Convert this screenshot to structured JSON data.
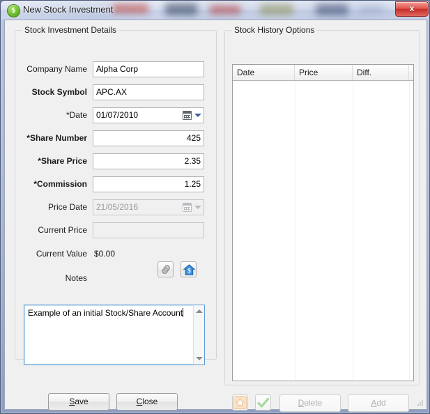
{
  "window": {
    "title": "New Stock Investment",
    "icon": "dollar-circle-icon",
    "close_label": "x"
  },
  "details_group": {
    "title": "Stock Investment Details",
    "fields": [
      {
        "label": "Company Name",
        "value": "Alpha Corp",
        "bold": false,
        "type": "text",
        "align": "left",
        "disabled": false
      },
      {
        "label": "Stock Symbol",
        "value": "APC.AX",
        "bold": true,
        "type": "text",
        "align": "left",
        "disabled": false
      },
      {
        "label": "*Date",
        "value": "01/07/2010",
        "bold": false,
        "type": "date",
        "align": "left",
        "disabled": false
      },
      {
        "label": "*Share Number",
        "value": "425",
        "bold": true,
        "type": "number",
        "align": "right",
        "disabled": false
      },
      {
        "label": "*Share Price",
        "value": "2.35",
        "bold": true,
        "type": "number",
        "align": "right",
        "disabled": false
      },
      {
        "label": "*Commission",
        "value": "1.25",
        "bold": true,
        "type": "number",
        "align": "right",
        "disabled": false
      },
      {
        "label": "Price Date",
        "value": "21/05/2016",
        "bold": false,
        "type": "date",
        "align": "left",
        "disabled": true
      },
      {
        "label": "Current Price",
        "value": "",
        "bold": false,
        "type": "text",
        "align": "left",
        "disabled": true
      }
    ],
    "current_value_label": "Current Value",
    "current_value": "$0.00",
    "notes_label": "Notes",
    "notes_text": "Example of an initial Stock/Share Account",
    "attach_icon": "paperclip-icon",
    "house_icon": "house-dollar-icon"
  },
  "history_group": {
    "title": "Stock History Options",
    "columns": [
      "Date",
      "Price",
      "Diff."
    ],
    "rows": [],
    "star_icon": "star-icon",
    "check_icon": "green-check-icon",
    "delete_label": "Delete",
    "delete_mnemonic": "D",
    "add_label": "Add",
    "add_mnemonic": "A"
  },
  "footer": {
    "save_label": "Save",
    "save_mnemonic": "S",
    "close_label": "Close",
    "close_mnemonic": "C"
  },
  "colors": {
    "accent_blue": "#3f6098",
    "close_red": "#c62f28",
    "icon_green": "#6fbf2e",
    "focus_border": "#5b9bd5",
    "star_orange": "#f0a050"
  }
}
